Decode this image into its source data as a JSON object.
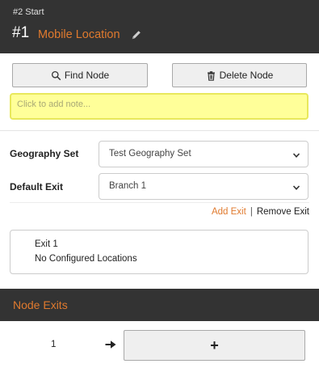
{
  "header": {
    "breadcrumb": "#2 Start",
    "node_number": "#1",
    "node_title": "Mobile Location",
    "edit_icon": "pencil-icon"
  },
  "toolbar": {
    "find_label": "Find Node",
    "find_icon": "search-icon",
    "delete_label": "Delete Node",
    "delete_icon": "trash-icon"
  },
  "note": {
    "placeholder": "Click to add note..."
  },
  "form": {
    "geography_label": "Geography Set",
    "geography_value": "Test Geography Set",
    "default_exit_label": "Default Exit",
    "default_exit_value": "Branch 1"
  },
  "exit_actions": {
    "add_label": "Add Exit",
    "separator": "|",
    "remove_label": "Remove Exit"
  },
  "exit_card": {
    "name": "Exit 1",
    "description": "No Configured Locations"
  },
  "node_exits": {
    "title": "Node Exits",
    "rows": [
      {
        "number": "1",
        "button_label": "+"
      }
    ]
  },
  "colors": {
    "header_bg": "#333333",
    "accent": "#e07a2e",
    "note_bg": "#ffff99",
    "button_bg": "#efefef"
  }
}
